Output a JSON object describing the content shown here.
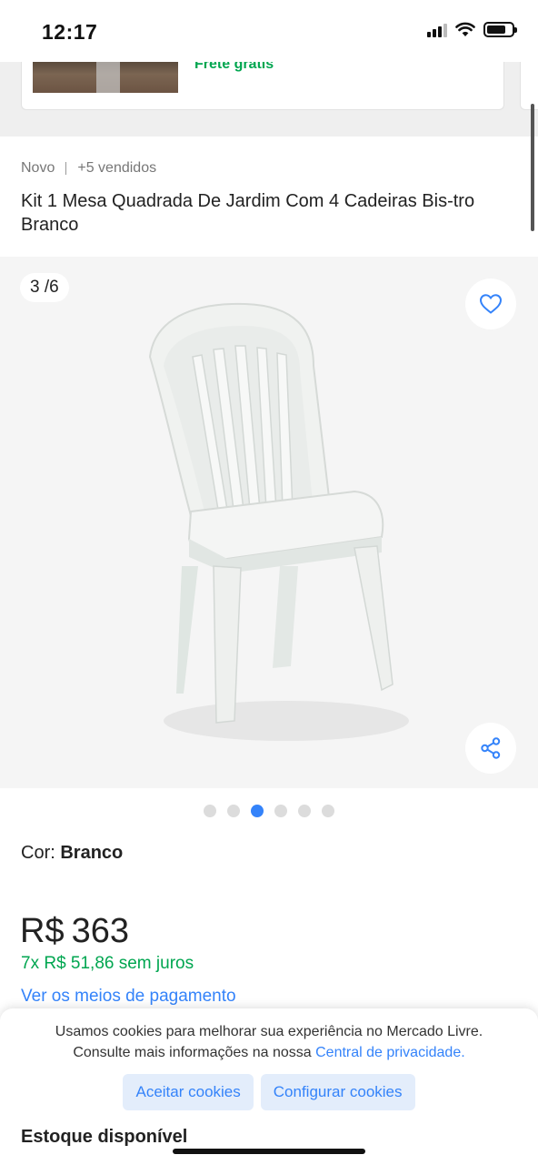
{
  "status_bar": {
    "time": "12:17"
  },
  "previous_card": {
    "shipping": "Frete grátis"
  },
  "product": {
    "condition": "Novo",
    "sold": "+5 vendidos",
    "title": "Kit 1 Mesa Quadrada De Jardim Com 4 Cadeiras Bis-tro Branco"
  },
  "gallery": {
    "counter": "3 /6",
    "total_images": 6,
    "active_index": 3,
    "favorite_icon": "heart-icon",
    "share_icon": "share-icon"
  },
  "variation": {
    "label": "Cor:",
    "value": "Branco"
  },
  "pricing": {
    "currency": "R$",
    "amount": "363",
    "installments": "7x R$ 51,86 sem juros",
    "payment_link": "Ver os meios de pagamento"
  },
  "cookies": {
    "text_line1": "Usamos cookies para melhorar sua experiência no Mercado Livre.",
    "text_line2": "Consulte mais informações na nossa",
    "privacy_link": "Central de privacidade.",
    "accept_label": "Aceitar cookies",
    "configure_label": "Configurar cookies"
  },
  "stock": {
    "label": "Estoque disponível"
  },
  "colors": {
    "accent": "#3483fa",
    "green": "#00a650",
    "gallery_bg": "#f5f5f5"
  }
}
